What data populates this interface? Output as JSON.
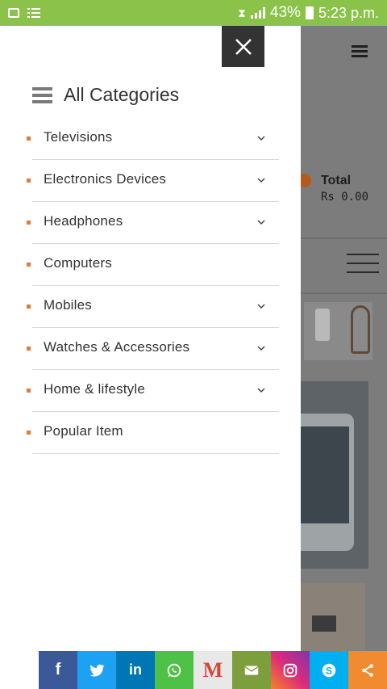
{
  "status_bar": {
    "battery_percent": "43%",
    "clock": "5:23 p.m."
  },
  "background_page": {
    "cart_total_label": "Total",
    "cart_total_value": "Rs 0.00"
  },
  "drawer": {
    "title": "All Categories",
    "items": [
      {
        "label": "Televisions",
        "has_submenu": true
      },
      {
        "label": "Electronics Devices",
        "has_submenu": true
      },
      {
        "label": "Headphones",
        "has_submenu": true
      },
      {
        "label": "Computers",
        "has_submenu": false
      },
      {
        "label": "Mobiles",
        "has_submenu": true
      },
      {
        "label": "Watches & Accessories",
        "has_submenu": true
      },
      {
        "label": "Home & lifestyle",
        "has_submenu": true
      },
      {
        "label": "Popular Item",
        "has_submenu": false
      }
    ]
  },
  "share_bar": {
    "buttons": [
      {
        "icon": "facebook-icon",
        "glyph": "f",
        "color": "#3b5998"
      },
      {
        "icon": "twitter-icon",
        "glyph": "",
        "color": "#1da1f2"
      },
      {
        "icon": "linkedin-icon",
        "glyph": "in",
        "color": "#0077b5"
      },
      {
        "icon": "whatsapp-icon",
        "glyph": "",
        "color": "#4dc247"
      },
      {
        "icon": "gmail-icon",
        "glyph": "M",
        "color": "#e8e8e8"
      },
      {
        "icon": "email-icon",
        "glyph": "",
        "color": "#7d9e3c"
      },
      {
        "icon": "instagram-icon",
        "glyph": "",
        "color": "#c13584"
      },
      {
        "icon": "skype-icon",
        "glyph": "S",
        "color": "#00aff0"
      },
      {
        "icon": "share-icon",
        "glyph": "",
        "color": "#f28a30"
      }
    ]
  }
}
